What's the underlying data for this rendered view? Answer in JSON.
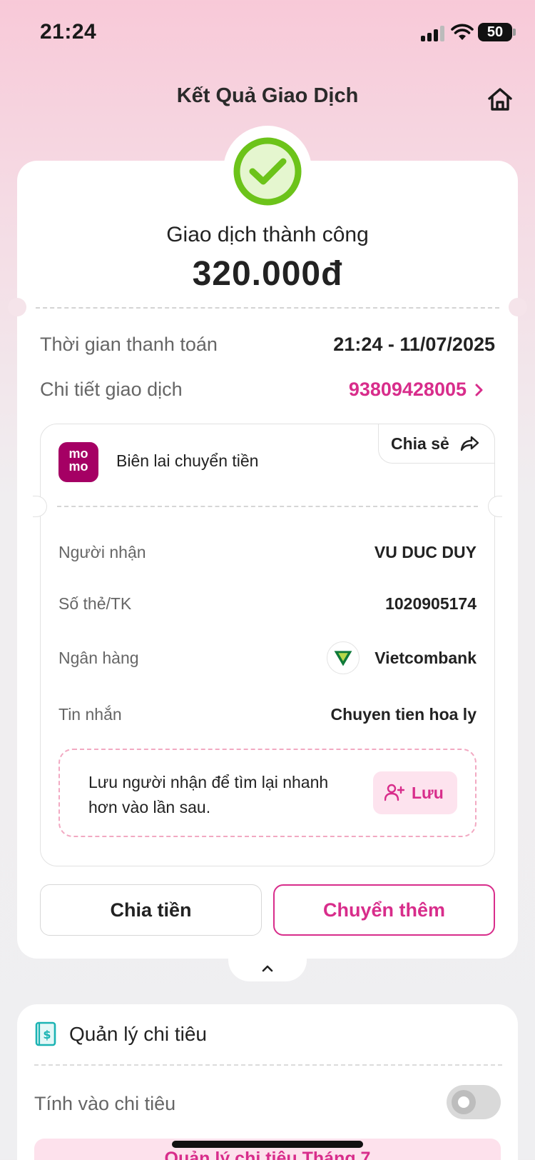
{
  "status_bar": {
    "time": "21:24",
    "battery": "50"
  },
  "header": {
    "title": "Kết Quả Giao Dịch"
  },
  "result": {
    "status_text": "Giao dịch thành công",
    "amount": "320.000đ"
  },
  "summary": {
    "time_label": "Thời gian thanh toán",
    "time_value": "21:24 - 11/07/2025",
    "detail_label": "Chi tiết giao dịch",
    "detail_value": "93809428005"
  },
  "receipt": {
    "logo_text": "mo mo",
    "title": "Biên lai chuyển tiền",
    "share_label": "Chia sẻ",
    "recipient_label": "Người nhận",
    "recipient_value": "VU DUC DUY",
    "account_label": "Số thẻ/TK",
    "account_value": "1020905174",
    "bank_label": "Ngân hàng",
    "bank_value": "Vietcombank",
    "message_label": "Tin nhắn",
    "message_value": "Chuyen tien hoa ly",
    "save_prompt": "Lưu người nhận để tìm lại nhanh hơn vào lần sau.",
    "save_button": "Lưu"
  },
  "actions": {
    "split_label": "Chia tiền",
    "more_label": "Chuyển thêm"
  },
  "spending": {
    "title": "Quản lý chi tiêu",
    "include_label": "Tính vào chi tiêu",
    "include_enabled": false,
    "month_banner": "Quản lý chi tiêu Tháng 7"
  },
  "colors": {
    "brand_pink": "#d82d8b",
    "success_green": "#6cc31a",
    "momo": "#a50064"
  },
  "icons": [
    "home-icon",
    "check-circle-icon",
    "chevron-right-icon",
    "share-icon",
    "vietcombank-logo-icon",
    "add-user-icon",
    "chevron-up-icon",
    "wallet-icon"
  ]
}
